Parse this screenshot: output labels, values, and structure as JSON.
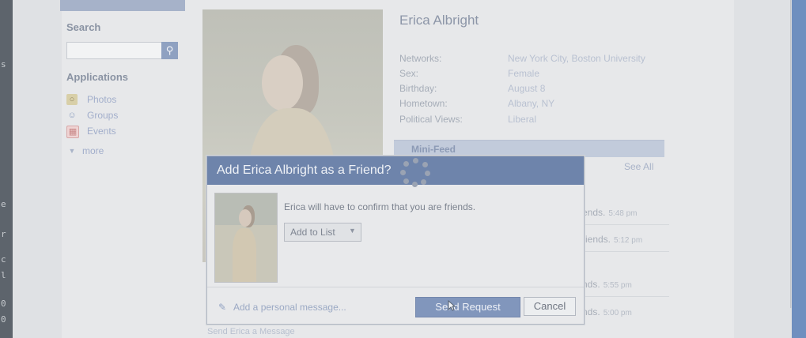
{
  "sidebar": {
    "search_label": "Search",
    "search_button_icon": "search-icon",
    "applications_label": "Applications",
    "apps": [
      {
        "label": "Photos",
        "icon": "photos-icon",
        "color": "#c9b98a"
      },
      {
        "label": "Groups",
        "icon": "groups-icon",
        "color": "#8fa1c1"
      },
      {
        "label": "Events",
        "icon": "calendar-icon",
        "color": "#d99a9a"
      }
    ],
    "more_label": "more"
  },
  "profile": {
    "name": "Erica Albright",
    "info": [
      {
        "key": "Networks:",
        "value": "New York City, Boston University"
      },
      {
        "key": "Sex:",
        "value": "Female"
      },
      {
        "key": "Birthday:",
        "value": "August 8"
      },
      {
        "key": "Hometown:",
        "value": "Albany, NY"
      },
      {
        "key": "Political Views:",
        "value": "Liberal"
      }
    ],
    "minifeed_label": "Mini-Feed",
    "see_all": "See All",
    "feed": [
      {
        "text": "ends.",
        "time": "5:48 pm"
      },
      {
        "text": "riends.",
        "time": "5:12 pm"
      },
      {
        "text": "nds.",
        "time": "5:55 pm"
      },
      {
        "text": "nds.",
        "time": "5:00 pm"
      }
    ],
    "send_message_link": "Send Erica a Message"
  },
  "dialog": {
    "title": "Add Erica Albright as a Friend?",
    "confirm_text": "Erica will have to confirm that you are friends.",
    "add_to_list": "Add to List",
    "personal_message": "Add a personal message...",
    "send_button": "Send Request",
    "cancel_button": "Cancel"
  },
  "colors": {
    "header_blue": "#6e84ab",
    "button_blue": "#8196bc",
    "link_blue": "#9ba9c4"
  }
}
